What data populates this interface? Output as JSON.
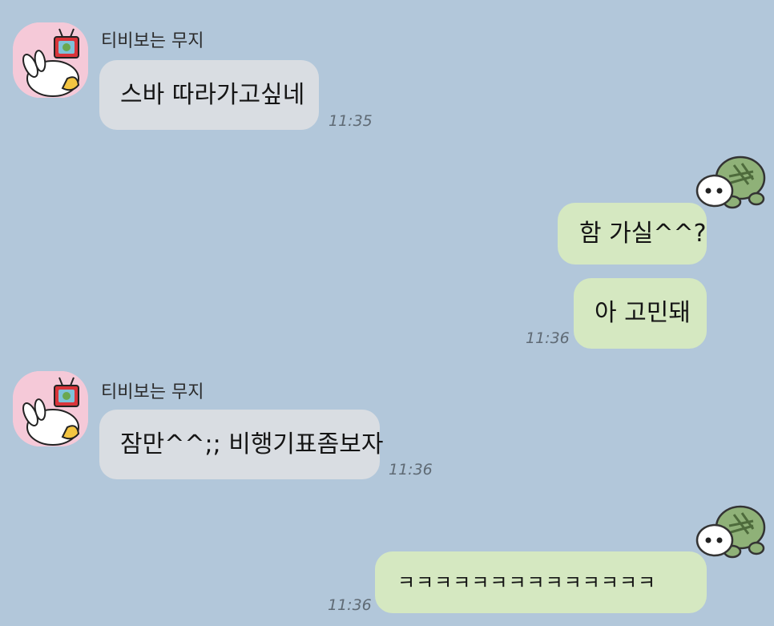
{
  "chat": {
    "messages": [
      {
        "sender": "티비보는 무지",
        "text": "스바 따라가고싶네",
        "time": "11:35"
      },
      {
        "text": "함 가실^^?"
      },
      {
        "text": "아 고민돼",
        "time": "11:36"
      },
      {
        "sender": "티비보는 무지",
        "text": "잠만^^;; 비행기표좀보자",
        "time": "11:36"
      },
      {
        "text": "ㅋㅋㅋㅋㅋㅋㅋㅋㅋㅋㅋㅋㅋㅋ",
        "time": "11:36"
      }
    ]
  },
  "colors": {
    "background": "#b2c7da",
    "incoming_bubble": "#d9dde2",
    "outgoing_bubble": "#d5e8c1",
    "avatar_bg": "#f5c9d8"
  },
  "icons": {
    "friend_avatar": "muzi-watching-tv-avatar",
    "my_profile": "turtle-icon"
  }
}
